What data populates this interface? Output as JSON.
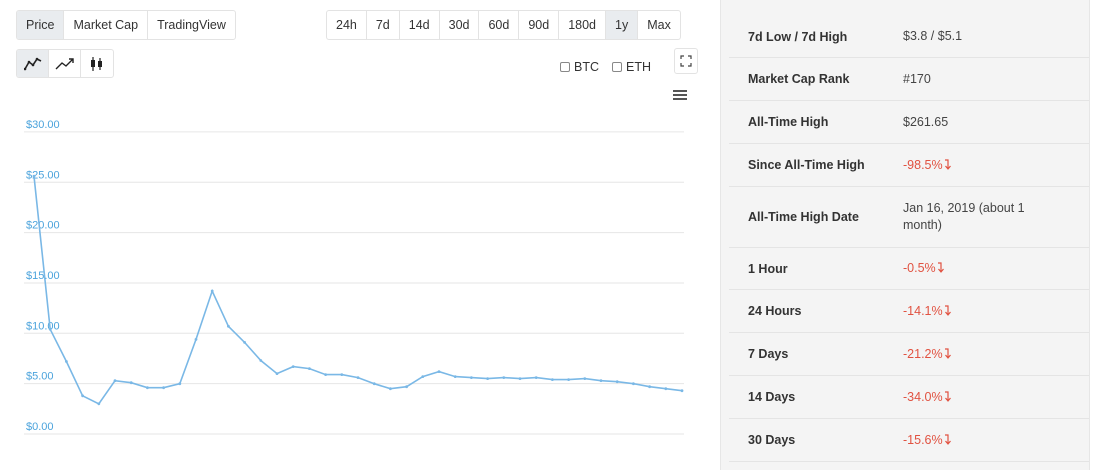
{
  "tabs": [
    {
      "label": "Price",
      "active": true
    },
    {
      "label": "Market Cap",
      "active": false
    },
    {
      "label": "TradingView",
      "active": false
    }
  ],
  "ranges": [
    {
      "label": "24h",
      "active": false
    },
    {
      "label": "7d",
      "active": false
    },
    {
      "label": "14d",
      "active": false
    },
    {
      "label": "30d",
      "active": false
    },
    {
      "label": "60d",
      "active": false
    },
    {
      "label": "90d",
      "active": false
    },
    {
      "label": "180d",
      "active": false
    },
    {
      "label": "1y",
      "active": true
    },
    {
      "label": "Max",
      "active": false
    }
  ],
  "chart_types": [
    {
      "icon": "line-chart-icon",
      "active": true
    },
    {
      "icon": "trend-arrow-icon",
      "active": false
    },
    {
      "icon": "candlestick-icon",
      "active": false
    }
  ],
  "compare": {
    "btc": "BTC",
    "eth": "ETH"
  },
  "icons": {
    "expand": "expand-icon",
    "menu": "hamburger-menu-icon"
  },
  "colors": {
    "line": "#7ab8e6",
    "axis_label": "#4ba3dc",
    "negative": "#e15241",
    "active_button": "#e9ecef"
  },
  "chart_data": {
    "type": "line",
    "y_tick_labels": [
      "$30.00",
      "$25.00",
      "$20.00",
      "$15.00",
      "$10.00",
      "$5.00",
      "$0.00"
    ],
    "ylim": [
      0,
      30
    ],
    "grid": true,
    "series": [
      {
        "values": [
          25.2,
          10.0,
          6.8,
          3.4,
          2.6,
          4.9,
          4.7,
          4.2,
          4.2,
          4.6,
          9.0,
          13.8,
          10.3,
          8.7,
          6.9,
          5.6,
          6.3,
          6.1,
          5.5,
          5.5,
          5.2,
          4.6,
          4.1,
          4.3,
          5.3,
          5.8,
          5.3,
          5.2,
          5.1,
          5.2,
          5.1,
          5.2,
          5.0,
          5.0,
          5.1,
          4.9,
          4.8,
          4.6,
          4.3,
          4.1,
          3.9
        ]
      }
    ]
  },
  "stats": [
    {
      "label": "7d Low / 7d High",
      "value": "$3.8 / $5.1",
      "negative": false
    },
    {
      "label": "Market Cap Rank",
      "value": "#170",
      "negative": false
    },
    {
      "label": "All-Time High",
      "value": "$261.65",
      "negative": false
    },
    {
      "label": "Since All-Time High",
      "value": "-98.5%",
      "negative": true
    },
    {
      "label": "All-Time High Date",
      "value": "Jan 16, 2019 (about 1 month)",
      "negative": false
    },
    {
      "label": "1 Hour",
      "value": "-0.5%",
      "negative": true
    },
    {
      "label": "24 Hours",
      "value": "-14.1%",
      "negative": true
    },
    {
      "label": "7 Days",
      "value": "-21.2%",
      "negative": true
    },
    {
      "label": "14 Days",
      "value": "-34.0%",
      "negative": true
    },
    {
      "label": "30 Days",
      "value": "-15.6%",
      "negative": true
    }
  ]
}
